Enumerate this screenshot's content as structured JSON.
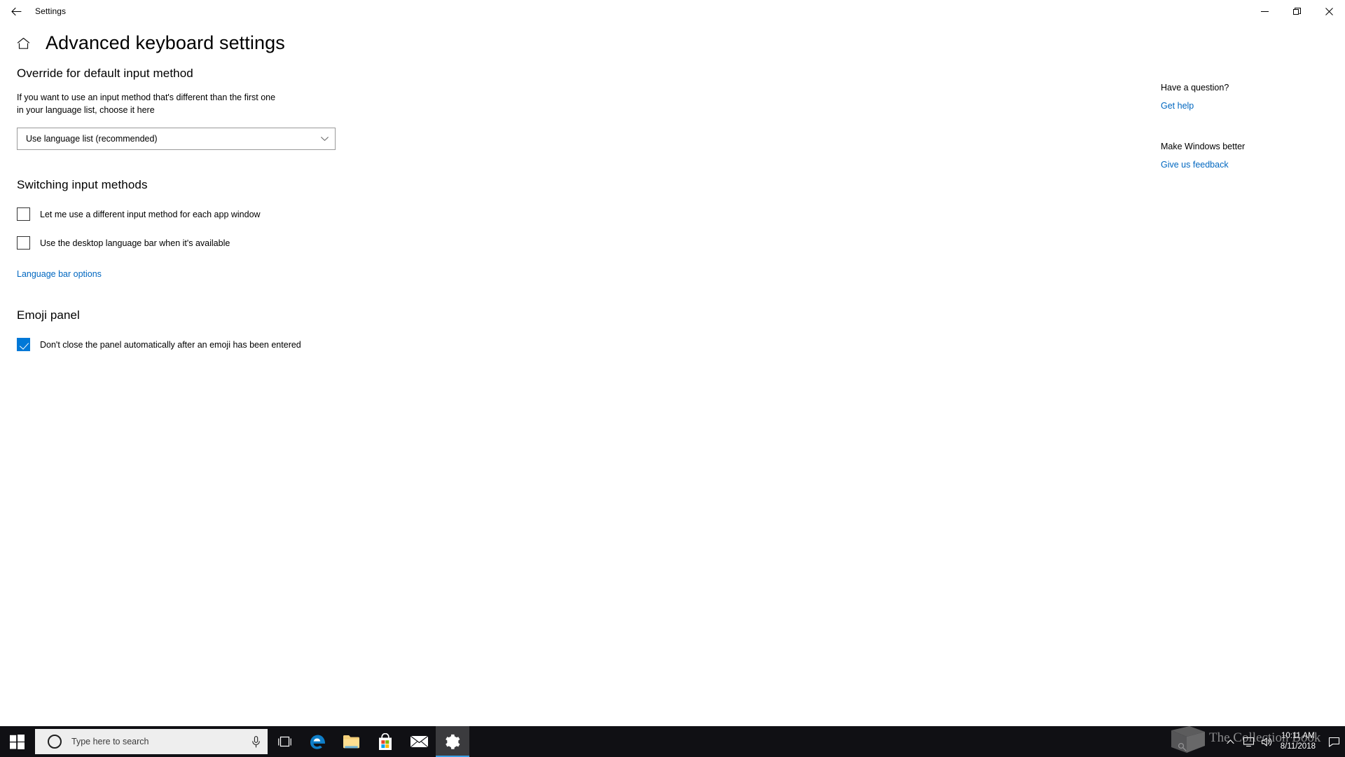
{
  "window": {
    "app_title": "Settings",
    "back_icon": "back-arrow-icon",
    "minimize_label": "Minimize",
    "restore_label": "Restore",
    "close_label": "Close"
  },
  "header": {
    "home_icon": "home-icon",
    "page_title": "Advanced keyboard settings"
  },
  "override_section": {
    "heading": "Override for default input method",
    "description": "If you want to use an input method that's different than the first one in your language list, choose it here",
    "dropdown_value": "Use language list (recommended)",
    "dropdown_icon": "chevron-down-icon"
  },
  "switching_section": {
    "heading": "Switching input methods",
    "checkboxes": [
      {
        "label": "Let me use a different input method for each app window",
        "checked": false
      },
      {
        "label": "Use the desktop language bar when it's available",
        "checked": false
      }
    ],
    "link": "Language bar options"
  },
  "emoji_section": {
    "heading": "Emoji panel",
    "checkbox": {
      "label": "Don't close the panel automatically after an emoji has been entered",
      "checked": true
    }
  },
  "sidebar": {
    "question_heading": "Have a question?",
    "question_link": "Get help",
    "feedback_heading": "Make Windows better",
    "feedback_link": "Give us feedback"
  },
  "watermark": {
    "text": "The Collection Book",
    "logo_icon": "book-logo-icon"
  },
  "taskbar": {
    "start_icon": "windows-start-icon",
    "cortana_icon": "cortana-circle-icon",
    "search_placeholder": "Type here to search",
    "mic_icon": "microphone-icon",
    "taskview_icon": "task-view-icon",
    "apps": [
      {
        "name": "edge-icon",
        "active": false
      },
      {
        "name": "file-explorer-icon",
        "active": false
      },
      {
        "name": "microsoft-store-icon",
        "active": false
      },
      {
        "name": "mail-icon",
        "active": false
      },
      {
        "name": "settings-gear-icon",
        "active": true
      }
    ],
    "tray_icons": [
      "show-hidden-icons-chevron",
      "display-icon",
      "volume-icon"
    ],
    "clock_time": "10:11 AM",
    "clock_date": "8/11/2018",
    "action_center_icon": "action-center-icon"
  },
  "colors": {
    "accent": "#0078d7",
    "link": "#0067c0",
    "taskbar": "#101014"
  }
}
